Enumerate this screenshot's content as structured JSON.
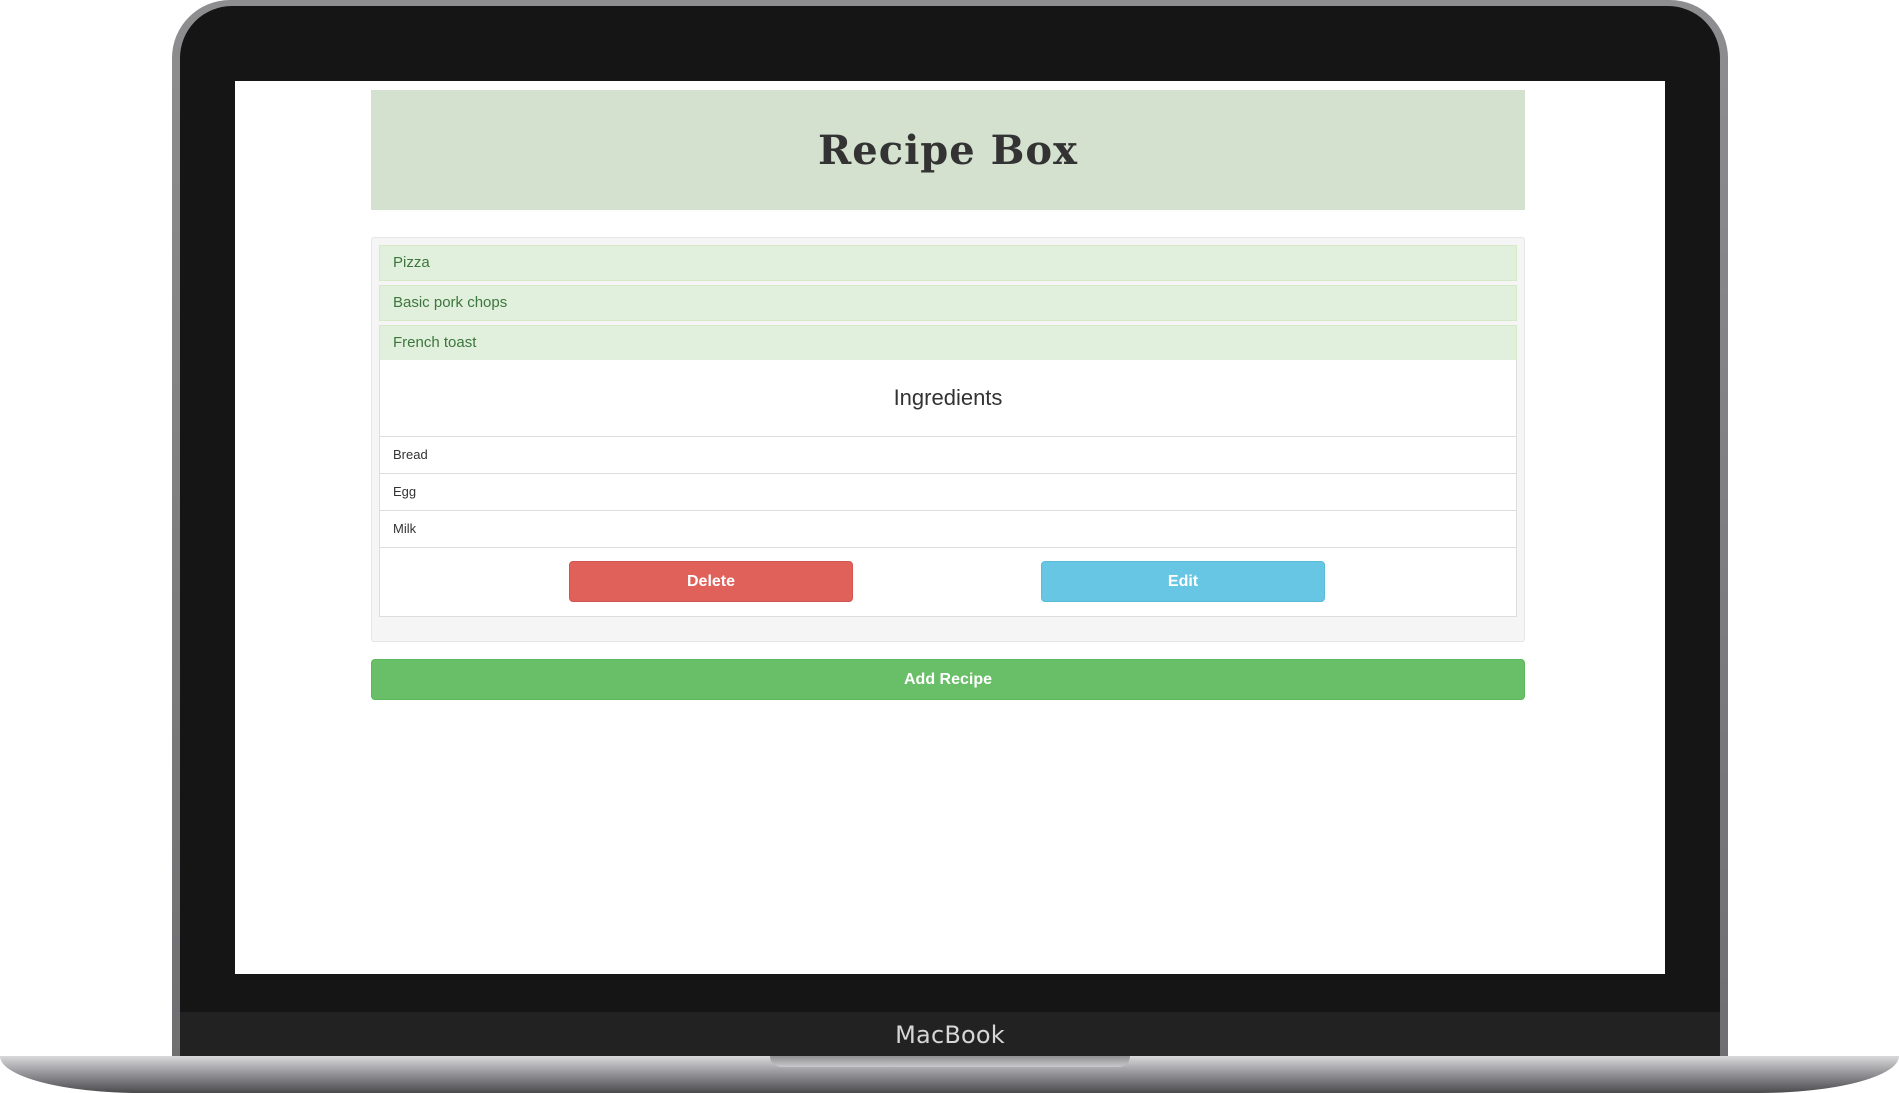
{
  "device": {
    "brand_label": "MacBook"
  },
  "app": {
    "title": "Recipe Box"
  },
  "recipes": [
    {
      "name": "Pizza",
      "expanded": false
    },
    {
      "name": "Basic pork chops",
      "expanded": false
    },
    {
      "name": "French toast",
      "expanded": true
    }
  ],
  "expanded_recipe": {
    "ingredients_heading": "Ingredients",
    "ingredients": [
      "Bread",
      "Egg",
      "Milk"
    ],
    "delete_label": "Delete",
    "edit_label": "Edit"
  },
  "add_button_label": "Add Recipe",
  "colors": {
    "header_bg": "#d4e1cf",
    "recipe_header_bg": "#e1f0dc",
    "recipe_header_text": "#3c763d",
    "delete_button": "#e0605a",
    "edit_button": "#67c6e3",
    "add_button": "#68bf68"
  }
}
